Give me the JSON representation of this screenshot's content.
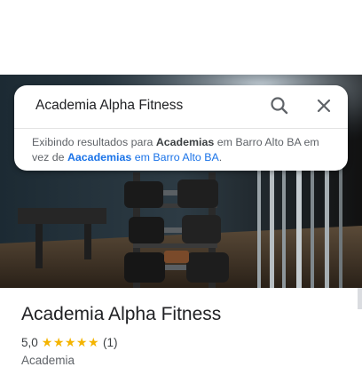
{
  "search": {
    "query": "Academia Alpha Fitness",
    "search_icon": "search-icon",
    "close_icon": "close-icon"
  },
  "suggestion": {
    "prefix": "Exibindo resultados para ",
    "shown_term": "Academias",
    "middle": " em Barro Alto BA em vez de ",
    "alt_term": "Aacademias",
    "alt_location": " em Barro Alto BA",
    "suffix": "."
  },
  "place": {
    "name": "Academia Alpha Fitness",
    "rating": "5,0",
    "stars": "★★★★★",
    "rating_value": 5,
    "review_count": "(1)",
    "category": "Academia"
  },
  "colors": {
    "star": "#f4b400",
    "link": "#1a73e8"
  }
}
